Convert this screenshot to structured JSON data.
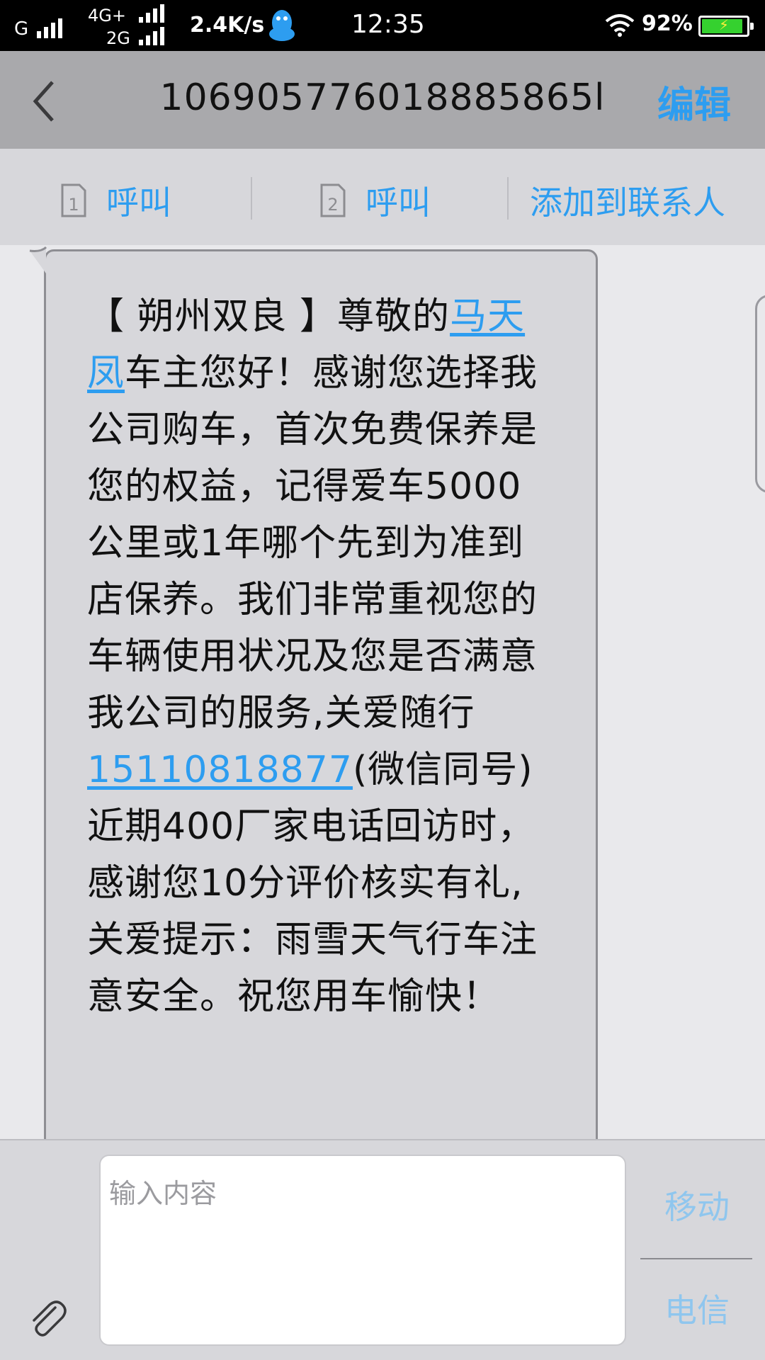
{
  "status_bar": {
    "network_1": "G",
    "network_2_top": "4G+",
    "network_2_bottom": "2G",
    "speed": "2.4K/s",
    "time": "12:35",
    "battery_percent": "92%",
    "battery_level": 0.92,
    "icons": [
      "signal-icon",
      "qq-icon",
      "wifi-icon",
      "battery-icon"
    ]
  },
  "header": {
    "title": "106905776018885865l",
    "edit_label": "编辑"
  },
  "actions": {
    "call1_label": "呼叫",
    "call2_label": "呼叫",
    "sim1_num": "1",
    "sim2_num": "2",
    "add_contact_label": "添加到联系人"
  },
  "message": {
    "part1": "【 朔州双良 】尊敬的",
    "name": "马天凤",
    "part2": "车主您好！感谢您选择我公司购车，首次免费保养是您的权益，记得爱车5000公里或1年哪个先到为准到店保养。我们非常重视您的车辆使用状况及您是否满意我公司的服务,关爱随行",
    "phone": "15110818877",
    "part3": "(微信同号)近期400厂家电话回访时，感谢您10分评价核实有礼,关爱提示：雨雪天气行车注意安全。祝您用车愉快！"
  },
  "composer": {
    "placeholder": "输入内容",
    "carrier_top": "移动",
    "carrier_bottom": "电信"
  },
  "colors": {
    "accent": "#2d9df0",
    "header_bg": "#a9a9ac",
    "bubble_bg": "#d7d7db"
  }
}
